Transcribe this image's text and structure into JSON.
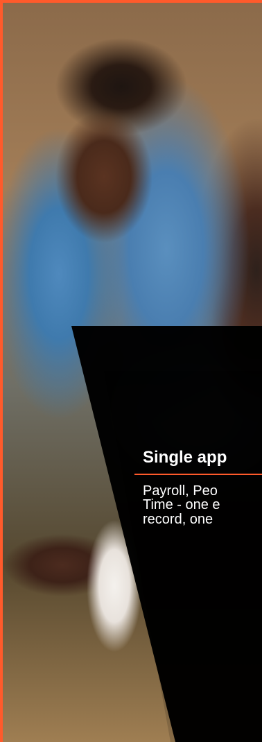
{
  "photo": {
    "icon": "photo-icon"
  },
  "feature": {
    "title": "Single app",
    "desc": {
      "line1": "Payroll, Peo",
      "line2": "Time - one e",
      "line3": "record, one"
    }
  },
  "colors": {
    "accent": "#ff5a2b",
    "text": "#ffffff",
    "overlay": "#000000"
  }
}
